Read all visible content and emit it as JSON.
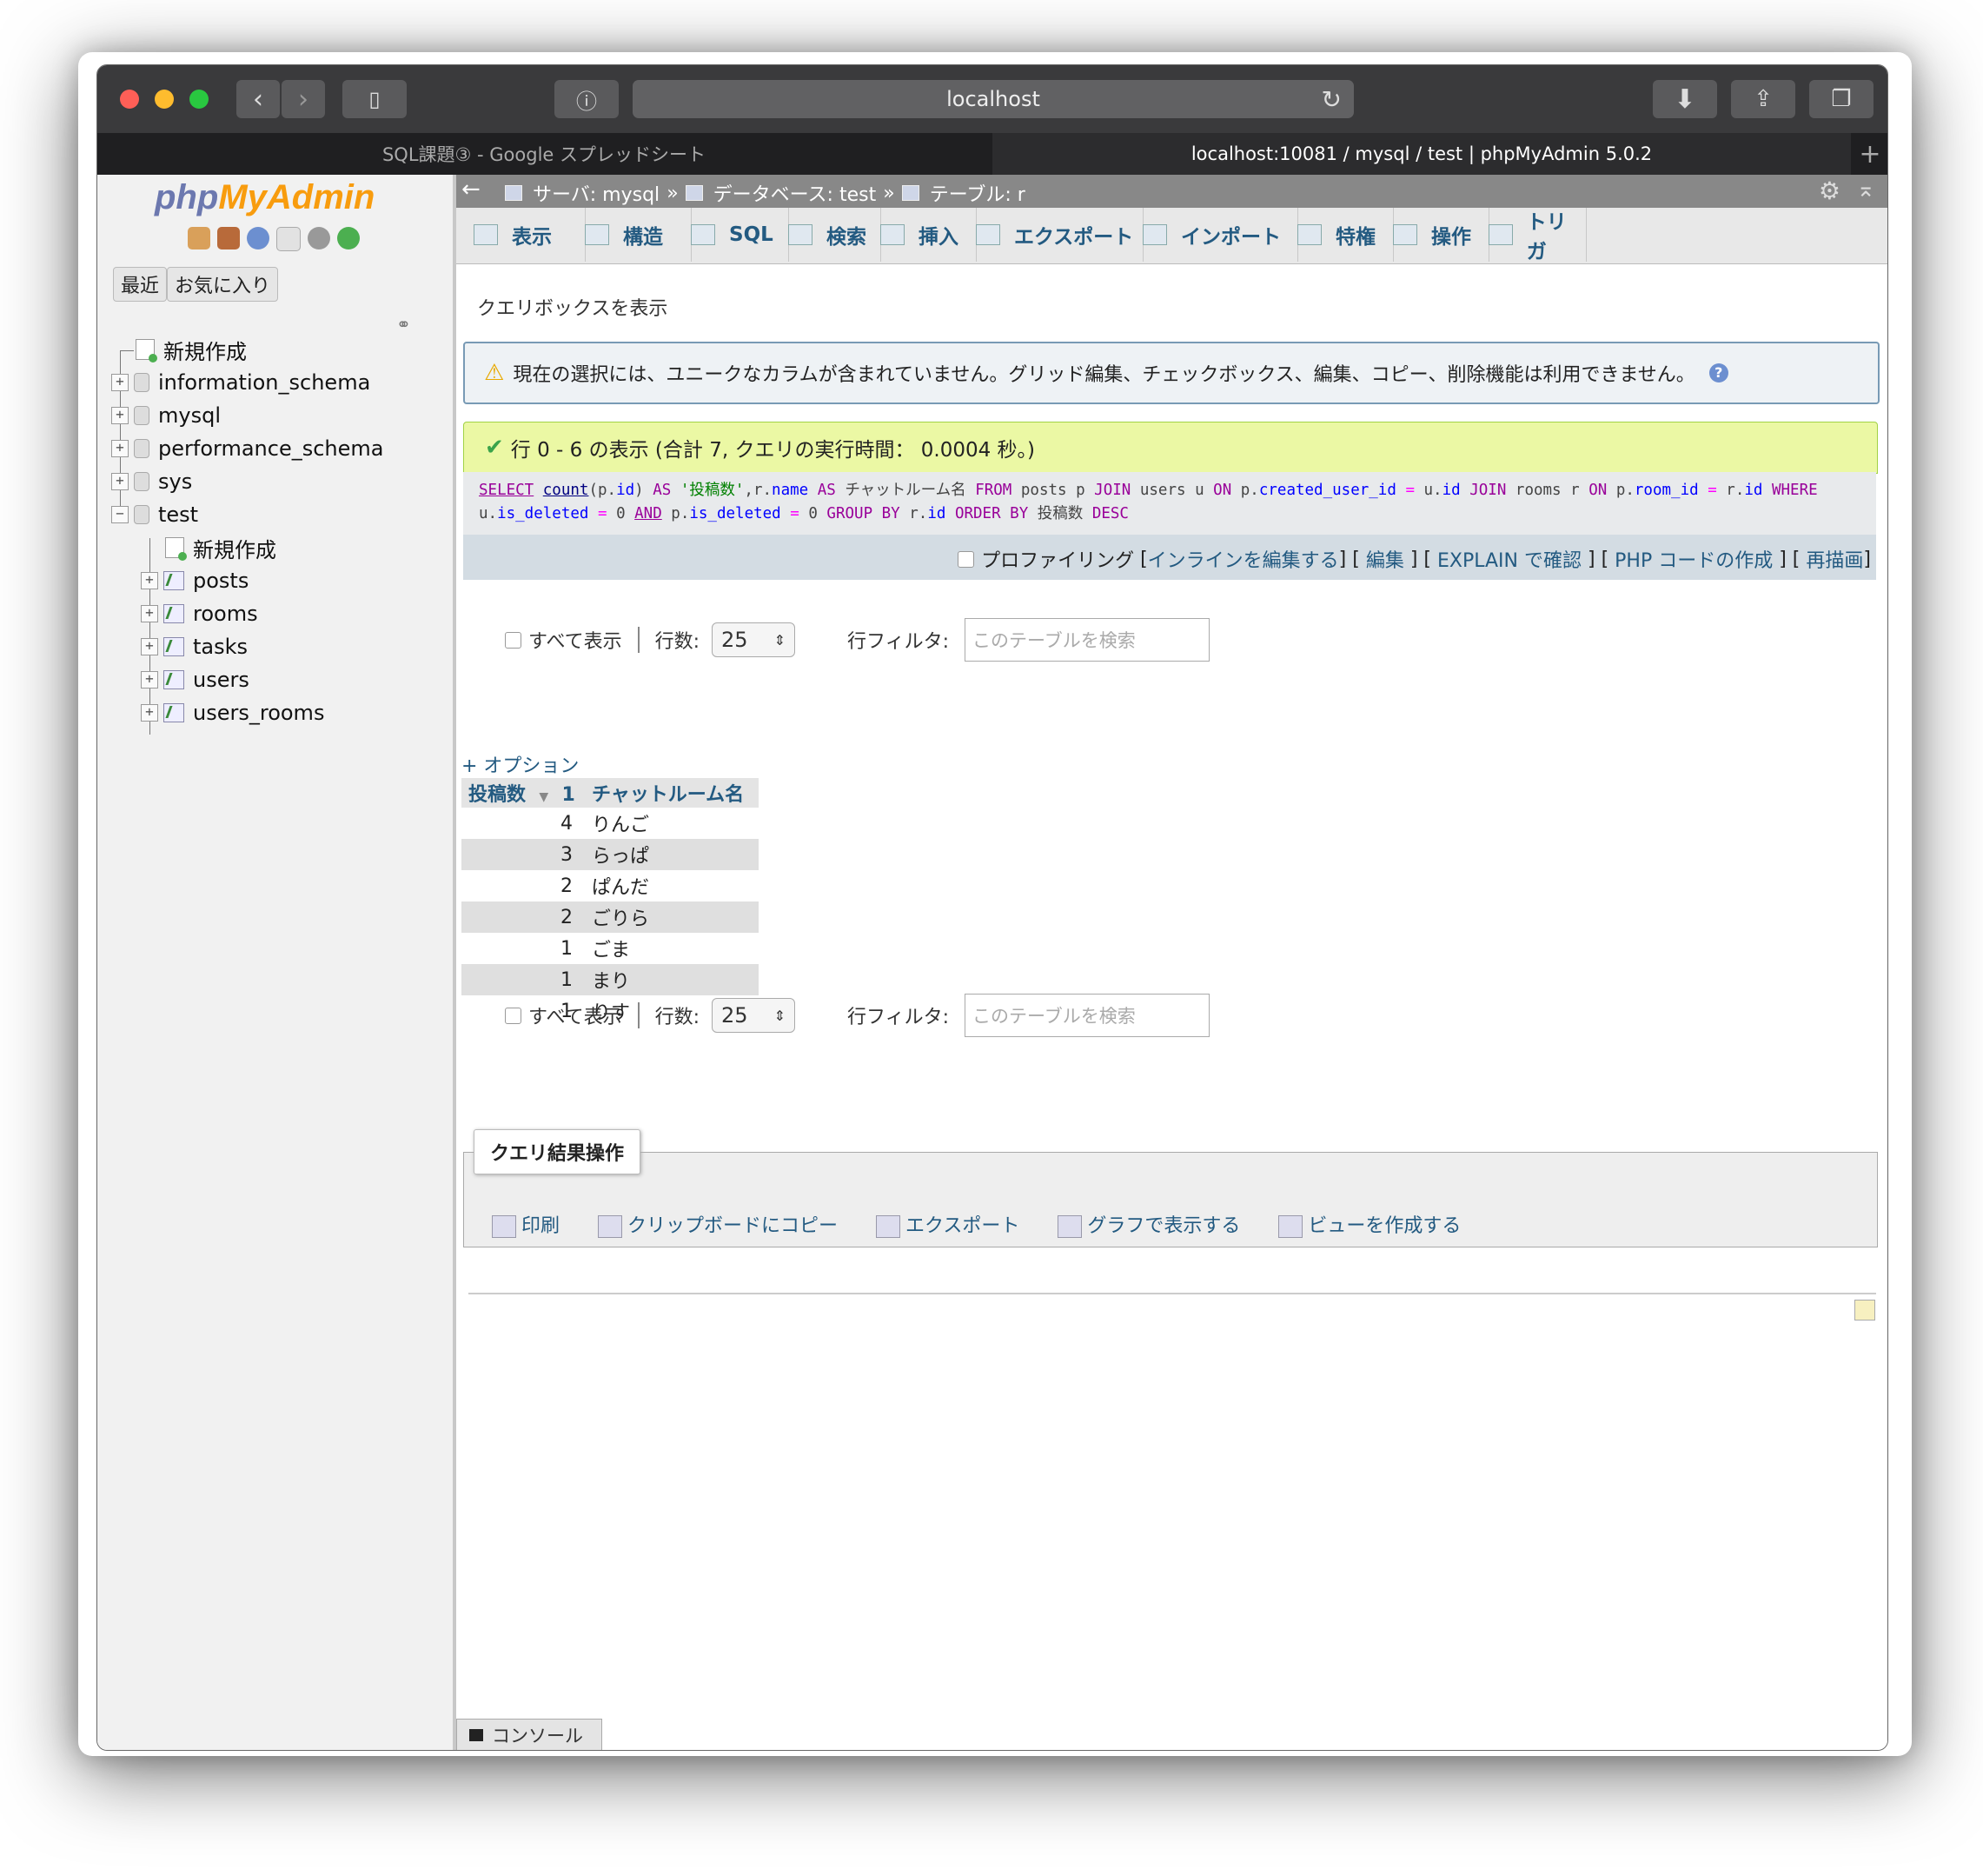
{
  "browser": {
    "url": "localhost",
    "tabs": [
      "SQL課題③ - Google スプレッドシート",
      "localhost:10081 / mysql / test | phpMyAdmin 5.0.2"
    ],
    "new_tab": "+"
  },
  "sidebar": {
    "logo_php": "php",
    "logo_myadmin": "MyAdmin",
    "recent": "最近",
    "favorites": "お気に入り",
    "tree": {
      "new": "新規作成",
      "databases": [
        "information_schema",
        "mysql",
        "performance_schema",
        "sys",
        "test"
      ],
      "test_new": "新規作成",
      "tables": [
        "posts",
        "rooms",
        "tasks",
        "users",
        "users_rooms"
      ]
    }
  },
  "breadcrumb": {
    "server": "サーバ: mysql",
    "database": "データベース: test",
    "table": "テーブル: r"
  },
  "menu": [
    "表示",
    "構造",
    "SQL",
    "検索",
    "挿入",
    "エクスポート",
    "インポート",
    "特権",
    "操作",
    "トリガ"
  ],
  "query_box_link": "クエリボックスを表示",
  "warning": "現在の選択には、ユニークなカラムが含まれていません。グリッド編集、チェックボックス、編集、コピー、削除機能は利用できません。",
  "success": "行 0 - 6 の表示 (合計 7, クエリの実行時間： 0.0004 秒。)",
  "sql_footer": {
    "profiling": "プロファイリング",
    "inline_edit": "インラインを編集する",
    "edit": "編集",
    "explain": "EXPLAIN で確認",
    "php": "PHP コードの作成",
    "refresh": "再描画"
  },
  "nav": {
    "show_all": "すべて表示",
    "rows_label": "行数:",
    "rows_value": "25",
    "filter_label": "行フィルタ:",
    "filter_placeholder": "このテーブルを検索"
  },
  "options_link": "+ オプション",
  "result": {
    "headers": [
      "投稿数",
      "チャットルーム名"
    ],
    "sort_index": "1",
    "rows": [
      {
        "count": "4",
        "name": "りんご"
      },
      {
        "count": "3",
        "name": "らっぱ"
      },
      {
        "count": "2",
        "name": "ぱんだ"
      },
      {
        "count": "2",
        "name": "ごりら"
      },
      {
        "count": "1",
        "name": "ごま"
      },
      {
        "count": "1",
        "name": "まり"
      },
      {
        "count": "1",
        "name": "りす"
      }
    ]
  },
  "query_ops": {
    "legend": "クエリ結果操作",
    "print": "印刷",
    "copy": "クリップボードにコピー",
    "export": "エクスポート",
    "chart": "グラフで表示する",
    "view": "ビューを作成する"
  },
  "console": "コンソール",
  "colors": {
    "link": "#235a81",
    "success_bg": "#ebf8a4",
    "warning_border": "#789ab5"
  }
}
